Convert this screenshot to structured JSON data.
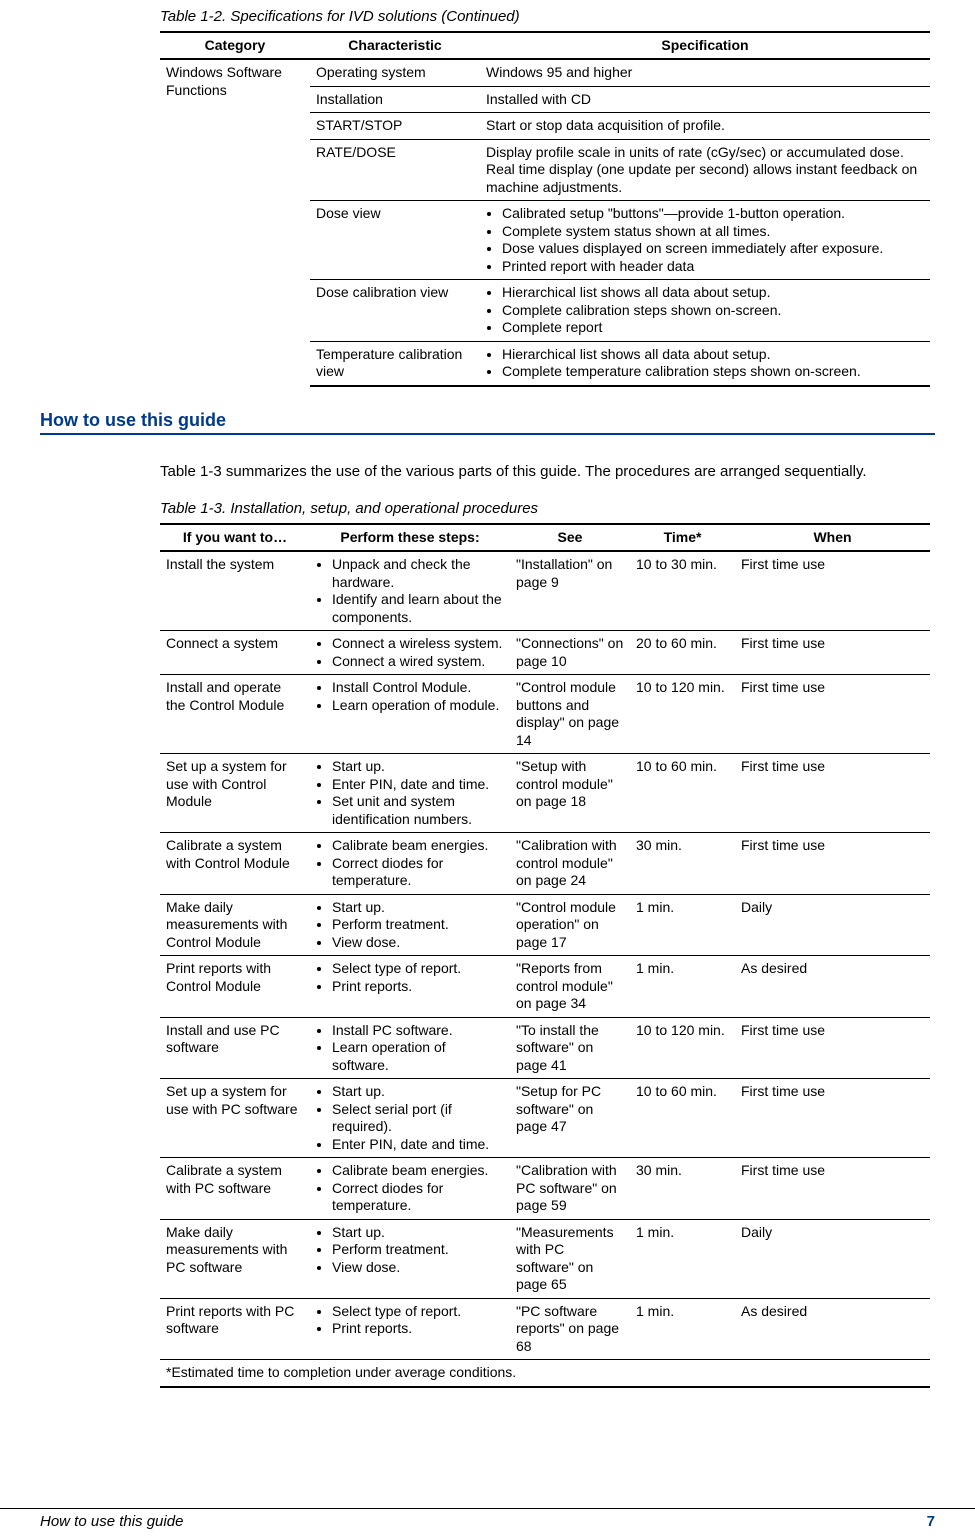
{
  "captions": {
    "table12": "Table 1-2. Specifications for IVD solutions  (Continued)",
    "table13": "Table 1-3. Installation, setup, and operational procedures"
  },
  "table12": {
    "headers": {
      "c1": "Category",
      "c2": "Characteristic",
      "c3": "Specification"
    },
    "category": "Windows Software Functions",
    "rows": {
      "r1": {
        "char": "Operating system",
        "spec": "Windows 95 and higher"
      },
      "r2": {
        "char": "Installation",
        "spec": "Installed with CD"
      },
      "r3": {
        "char": "START/STOP",
        "spec": "Start or stop data acquisition of profile."
      },
      "r4": {
        "char": "RATE/DOSE",
        "spec": "Display profile scale in units of rate (cGy/sec) or accumulated dose. Real time display (one update per second) allows instant feedback on machine adjustments."
      },
      "r5": {
        "char": "Dose view",
        "b1": "Calibrated setup \"buttons\"—provide 1-button operation.",
        "b2": "Complete system status shown at all times.",
        "b3": "Dose values displayed on screen immediately after exposure.",
        "b4": "Printed report with header data"
      },
      "r6": {
        "char": "Dose calibration view",
        "b1": "Hierarchical list shows all data about setup.",
        "b2": "Complete calibration steps shown on-screen.",
        "b3": "Complete report"
      },
      "r7": {
        "char": "Temperature calibration view",
        "b1": "Hierarchical list shows all data about setup.",
        "b2": "Complete temperature calibration steps shown on-screen."
      }
    }
  },
  "section_heading": "How to use this guide",
  "intro": "Table 1-3 summarizes the use of the various parts of this guide. The procedures are arranged sequentially.",
  "table13": {
    "headers": {
      "c1": "If you want to…",
      "c2": "Perform these steps:",
      "c3": "See",
      "c4": "Time*",
      "c5": "When"
    },
    "rows": {
      "r1": {
        "want": "Install the system",
        "b1": "Unpack and check the hardware.",
        "b2": "Identify and learn about the components.",
        "see": "\"Installation\" on page 9",
        "time": "10 to 30 min.",
        "when": "First time use"
      },
      "r2": {
        "want": "Connect a system",
        "b1": "Connect a wireless system.",
        "b2": "Connect a wired system.",
        "see": "\"Connections\" on page 10",
        "time": "20 to 60 min.",
        "when": "First time use"
      },
      "r3": {
        "want": "Install and operate the Control Module",
        "b1": "Install Control Module.",
        "b2": "Learn operation of module.",
        "see": "\"Control module buttons and display\" on page 14",
        "time": "10 to 120 min.",
        "when": "First time use"
      },
      "r4": {
        "want": "Set up a system for use with Control Module",
        "b1": "Start up.",
        "b2": "Enter PIN, date and time.",
        "b3": "Set unit and system identification numbers.",
        "see": "\"Setup with control module\" on page 18",
        "time": "10 to 60 min.",
        "when": "First time use"
      },
      "r5": {
        "want": "Calibrate a system with Control Module",
        "b1": "Calibrate beam energies.",
        "b2": "Correct diodes for temperature.",
        "see": "\"Calibration with control module\" on page 24",
        "time": "30 min.",
        "when": "First time use"
      },
      "r6": {
        "want": "Make daily measurements with Control Module",
        "b1": "Start up.",
        "b2": "Perform treatment.",
        "b3": "View dose.",
        "see": "\"Control module operation\" on page 17",
        "time": "1 min.",
        "when": "Daily"
      },
      "r7": {
        "want": "Print reports with Control Module",
        "b1": "Select type of report.",
        "b2": "Print reports.",
        "see": "\"Reports from control module\" on page 34",
        "time": "1 min.",
        "when": "As desired"
      },
      "r8": {
        "want": "Install and use PC software",
        "b1": "Install PC software.",
        "b2": "Learn operation of software.",
        "see": "\"To install the software\" on page 41",
        "time": "10 to 120 min.",
        "when": "First time use"
      },
      "r9": {
        "want": "Set up a system for use with PC software",
        "b1": "Start up.",
        "b2": "Select serial port (if required).",
        "b3": "Enter PIN, date and time.",
        "see": "\"Setup for PC software\" on page 47",
        "time": "10 to 60 min.",
        "when": "First time use"
      },
      "r10": {
        "want": "Calibrate a system with PC software",
        "b1": "Calibrate beam energies.",
        "b2": "Correct diodes for temperature.",
        "see": "\"Calibration with PC software\" on page 59",
        "time": "30 min.",
        "when": "First time use"
      },
      "r11": {
        "want": "Make daily measurements with PC software",
        "b1": "Start up.",
        "b2": "Perform treatment.",
        "b3": "View dose.",
        "see": "\"Measurements with PC software\" on page 65",
        "time": "1 min.",
        "when": "Daily"
      },
      "r12": {
        "want": "Print reports with PC software",
        "b1": "Select type of report.",
        "b2": "Print reports.",
        "see": "\"PC software reports\" on page 68",
        "time": "1 min.",
        "when": "As desired"
      }
    },
    "footnote": "*Estimated time to completion under average conditions."
  },
  "footer": {
    "left": "How to use this guide",
    "page": "7"
  }
}
